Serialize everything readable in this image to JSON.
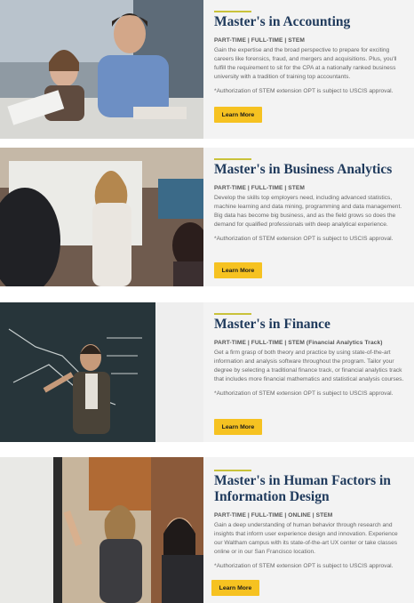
{
  "programs": [
    {
      "title": "Master's in Accounting",
      "meta": "PART-TIME | FULL-TIME | STEM",
      "description": "Gain the expertise and the broad perspective to prepare for exciting careers like forensics, fraud, and mergers and acquisitions. Plus, you'll fulfill the requirement to sit for the CPA at a nationally ranked business university with a tradition of training top accountants.",
      "note": "*Authorization of STEM extension OPT is subject to USCIS approval.",
      "button": "Learn More"
    },
    {
      "title": "Master's in Business Analytics",
      "meta": "PART-TIME | FULL-TIME | STEM",
      "description": "Develop the skills top employers need, including advanced statistics, machine learning and data mining, programming and data management. Big data has become big business, and as the field grows so does the demand for qualified professionals with deep analytical experience.",
      "note": "*Authorization of STEM extension OPT is subject to USCIS approval.",
      "button": "Learn More"
    },
    {
      "title": "Master's in Finance",
      "meta": "PART-TIME | FULL-TIME | STEM (Financial Analytics Track)",
      "description": "Get a firm grasp of both theory and practice by using state-of-the-art information and analysis software throughout the program. Tailor your degree by selecting a traditional finance track, or financial analytics track that includes more financial mathematics and statistical analysis courses.",
      "note": "*Authorization of STEM extension OPT is subject to USCIS approval.",
      "button": "Learn More"
    },
    {
      "title": "Master's in Human Factors in Information Design",
      "meta": "PART-TIME | FULL-TIME | ONLINE | STEM",
      "description": "Gain a deep understanding of human behavior through research and insights that inform user experience design and innovation. Experience our Waltham campus with its state-of-the-art UX center or take classes online or in our San Francisco location.",
      "note": "*Authorization of STEM extension OPT is subject to USCIS approval.",
      "button": "Learn More"
    }
  ],
  "colors": {
    "title": "#1f3a5c",
    "accent_rule": "#c9c23a",
    "button": "#f6c221",
    "card_bg": "#f3f3f3"
  }
}
